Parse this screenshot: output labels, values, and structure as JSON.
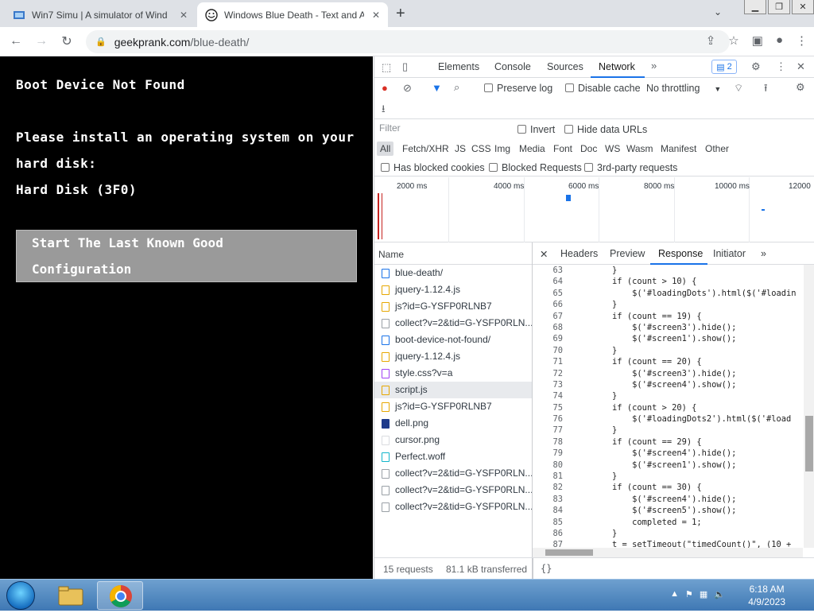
{
  "tabs": [
    {
      "title": "Win7 Simu | A simulator of Wind",
      "active": false
    },
    {
      "title": "Windows Blue Death - Text and A",
      "active": true
    }
  ],
  "address": {
    "domain": "geekprank.com",
    "path": "/blue-death/"
  },
  "bsod": {
    "line1": "Boot Device Not Found",
    "line2": "Please install an operating system on your",
    "line3": "hard disk:",
    "line4": "Hard Disk (3F0)",
    "option_line1": "Start The Last Known Good",
    "option_line2": "Configuration"
  },
  "devtools": {
    "tabs": [
      "Elements",
      "Console",
      "Sources",
      "Network"
    ],
    "active_tab": "Network",
    "issues_count": "2",
    "preserve_log": "Preserve log",
    "disable_cache": "Disable cache",
    "throttling": "No throttling",
    "filter_placeholder": "Filter",
    "invert": "Invert",
    "hide_data_urls": "Hide data URLs",
    "types": [
      "All",
      "Fetch/XHR",
      "JS",
      "CSS",
      "Img",
      "Media",
      "Font",
      "Doc",
      "WS",
      "Wasm",
      "Manifest",
      "Other"
    ],
    "has_blocked_cookies": "Has blocked cookies",
    "blocked_requests": "Blocked Requests",
    "third_party": "3rd-party requests",
    "timeline_ticks": [
      "2000 ms",
      "4000 ms",
      "6000 ms",
      "8000 ms",
      "10000 ms",
      "12000"
    ],
    "name_header": "Name",
    "requests": [
      {
        "name": "blue-death/",
        "type": "doc"
      },
      {
        "name": "jquery-1.12.4.js",
        "type": "js"
      },
      {
        "name": "js?id=G-YSFP0RLNB7",
        "type": "js"
      },
      {
        "name": "collect?v=2&tid=G-YSFP0RLN...",
        "type": "other"
      },
      {
        "name": "boot-device-not-found/",
        "type": "doc"
      },
      {
        "name": "jquery-1.12.4.js",
        "type": "js"
      },
      {
        "name": "style.css?v=a",
        "type": "css"
      },
      {
        "name": "script.js",
        "type": "js"
      },
      {
        "name": "js?id=G-YSFP0RLNB7",
        "type": "js"
      },
      {
        "name": "dell.png",
        "type": "img"
      },
      {
        "name": "cursor.png",
        "type": "img"
      },
      {
        "name": "Perfect.woff",
        "type": "font"
      },
      {
        "name": "collect?v=2&tid=G-YSFP0RLN...",
        "type": "other"
      },
      {
        "name": "collect?v=2&tid=G-YSFP0RLN...",
        "type": "other"
      },
      {
        "name": "collect?v=2&tid=G-YSFP0RLN...",
        "type": "other"
      }
    ],
    "selected_request": "script.js",
    "detail_tabs": [
      "Headers",
      "Preview",
      "Response",
      "Initiator"
    ],
    "active_detail_tab": "Response",
    "code_lines": [
      {
        "n": "63",
        "t": "        }"
      },
      {
        "n": "64",
        "t": "        if (count > 10) {"
      },
      {
        "n": "65",
        "t": "            $('#loadingDots').html($('#loadin"
      },
      {
        "n": "66",
        "t": "        }"
      },
      {
        "n": "67",
        "t": "        if (count == 19) {"
      },
      {
        "n": "68",
        "t": "            $('#screen3').hide();"
      },
      {
        "n": "69",
        "t": "            $('#screen1').show();"
      },
      {
        "n": "70",
        "t": "        }"
      },
      {
        "n": "71",
        "t": "        if (count == 20) {"
      },
      {
        "n": "72",
        "t": "            $('#screen3').hide();"
      },
      {
        "n": "73",
        "t": "            $('#screen4').show();"
      },
      {
        "n": "74",
        "t": "        }"
      },
      {
        "n": "75",
        "t": "        if (count > 20) {"
      },
      {
        "n": "76",
        "t": "            $('#loadingDots2').html($('#load"
      },
      {
        "n": "77",
        "t": "        }"
      },
      {
        "n": "78",
        "t": "        if (count == 29) {"
      },
      {
        "n": "79",
        "t": "            $('#screen4').hide();"
      },
      {
        "n": "80",
        "t": "            $('#screen1').show();"
      },
      {
        "n": "81",
        "t": "        }"
      },
      {
        "n": "82",
        "t": "        if (count == 30) {"
      },
      {
        "n": "83",
        "t": "            $('#screen4').hide();"
      },
      {
        "n": "84",
        "t": "            $('#screen5').show();"
      },
      {
        "n": "85",
        "t": "            completed = 1;"
      },
      {
        "n": "86",
        "t": "        }"
      },
      {
        "n": "87",
        "t": "        t = setTimeout(\"timedCount()\", (10 +"
      }
    ],
    "requests_count": "15 requests",
    "transferred": "81.1 kB transferred",
    "pretty_print": "{}"
  },
  "taskbar": {
    "time": "6:18 AM",
    "date": "4/9/2023"
  }
}
